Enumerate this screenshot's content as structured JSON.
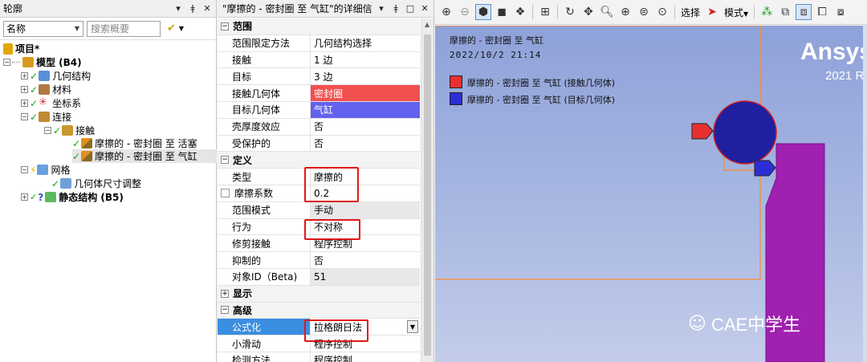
{
  "outline": {
    "title": "轮廓",
    "title_buttons": [
      "▾",
      "ǂ",
      "✕"
    ],
    "filter_combo": "名称",
    "search_placeholder": "搜索概要",
    "tree": [
      {
        "label": "项目*",
        "level": 0,
        "icon": "project-icon",
        "bold": true
      },
      {
        "label": "模型 (B4)",
        "level": 1,
        "icon": "model-icon",
        "bold": true
      },
      {
        "label": "几何结构",
        "level": 2,
        "icon": "geometry-icon"
      },
      {
        "label": "材料",
        "level": 2,
        "icon": "materials-icon"
      },
      {
        "label": "坐标系",
        "level": 2,
        "icon": "coordinate-system-icon"
      },
      {
        "label": "连接",
        "level": 2,
        "icon": "connections-icon"
      },
      {
        "label": "接触",
        "level": 3,
        "icon": "contacts-icon"
      },
      {
        "label": "摩擦的 - 密封圈 至 活塞",
        "level": 4,
        "icon": "contact-region-icon"
      },
      {
        "label": "摩擦的 - 密封圈 至 气缸",
        "level": 4,
        "icon": "contact-region-icon",
        "selected": true
      },
      {
        "label": "网格",
        "level": 2,
        "icon": "mesh-icon"
      },
      {
        "label": "几何体尺寸调整",
        "level": 3,
        "icon": "body-sizing-icon"
      },
      {
        "label": "静态结构 (B5)",
        "level": 1,
        "icon": "static-structural-icon",
        "bold": true
      }
    ]
  },
  "details": {
    "title": "\"摩擦的 - 密封圈 至 气缸\"的详细信",
    "title_buttons": [
      "▾",
      "ǂ",
      "□",
      "✕"
    ],
    "sections": {
      "scope": "范围",
      "definition": "定义",
      "display": "显示",
      "advanced": "高级"
    },
    "rows": {
      "scoping_method": {
        "k": "范围限定方法",
        "v": "几何结构选择"
      },
      "contact": {
        "k": "接触",
        "v": "1 边"
      },
      "target": {
        "k": "目标",
        "v": "3 边"
      },
      "contact_bodies": {
        "k": "接触几何体",
        "v": "密封圈"
      },
      "target_bodies": {
        "k": "目标几何体",
        "v": "气缸"
      },
      "shell_thickness": {
        "k": "壳厚度效应",
        "v": "否"
      },
      "protected": {
        "k": "受保护的",
        "v": "否"
      },
      "type": {
        "k": "类型",
        "v": "摩擦的"
      },
      "friction": {
        "k": "摩擦系数",
        "v": "0.2"
      },
      "scope_mode": {
        "k": "范围模式",
        "v": "手动"
      },
      "behavior": {
        "k": "行为",
        "v": "不对称"
      },
      "trim": {
        "k": "修剪接触",
        "v": "程序控制"
      },
      "suppressed": {
        "k": "抑制的",
        "v": "否"
      },
      "object_id": {
        "k": "对象ID（Beta)",
        "v": "51"
      },
      "formulation": {
        "k": "公式化",
        "v": "拉格朗日法"
      },
      "small_sliding": {
        "k": "小滑动",
        "v": "程序控制"
      },
      "detection": {
        "k": "检测方法",
        "v": "程序控制"
      }
    },
    "colors": {
      "contact_bodies": "#f05050",
      "target_bodies": "#6262ee",
      "highlight": "#e01818",
      "formulation_bg": "#3a8ee0"
    }
  },
  "toolbar": {
    "select_label": "选择",
    "mode_label": "模式"
  },
  "viewport": {
    "header_title": "摩擦的 - 密封圈 至 气缸",
    "timestamp": "2022/10/2 21:14",
    "legend": [
      {
        "label": "摩擦的 - 密封圈 至 气缸 (接触几何体)",
        "color": "#e83030"
      },
      {
        "label": "摩擦的 - 密封圈 至 气缸 (目标几何体)",
        "color": "#2d2dd6"
      }
    ],
    "brand": "Ansys",
    "brand_version": "2021 R",
    "watermark": "CAE中学生",
    "colors": {
      "seal": "#1f1fa0",
      "cylinder": "#a020b0",
      "outline": "#ff8a2a"
    }
  }
}
